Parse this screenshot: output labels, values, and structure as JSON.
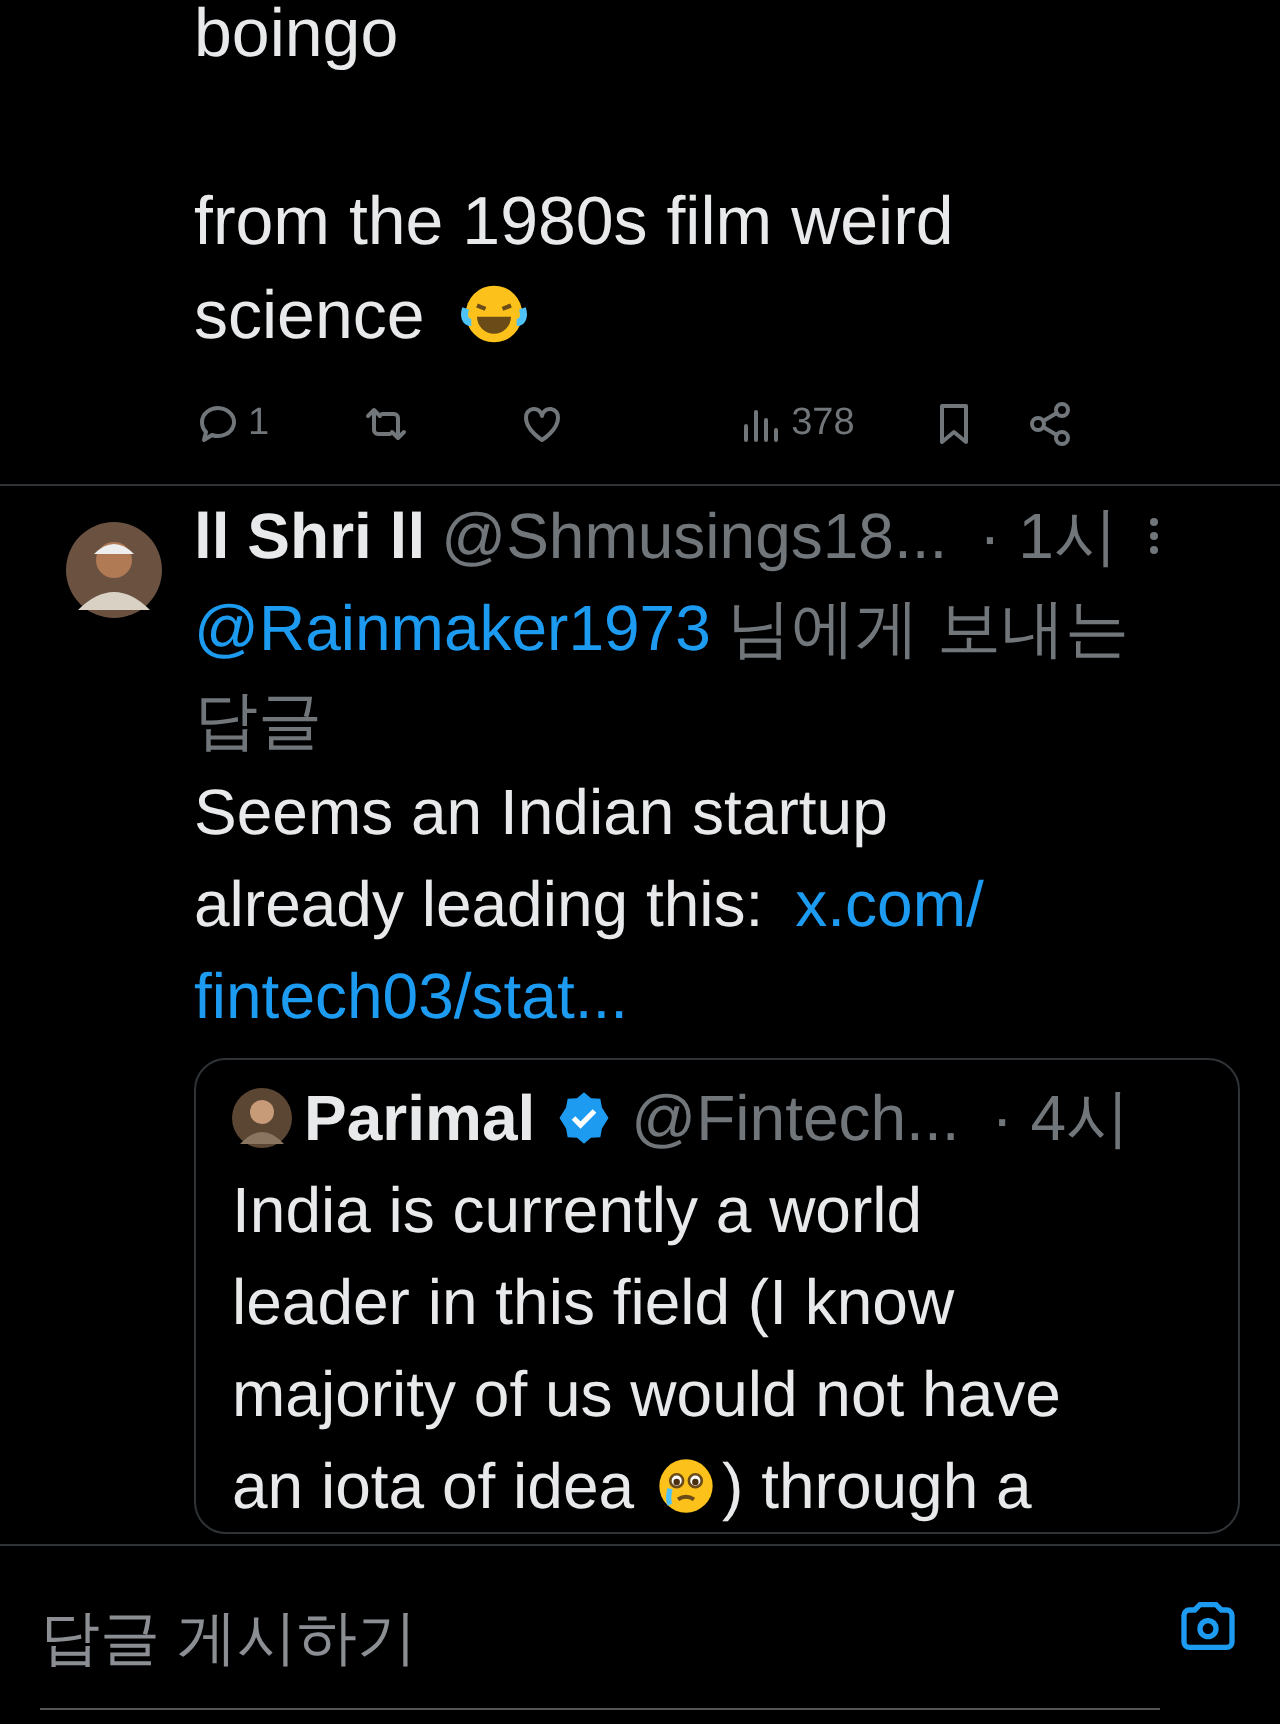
{
  "tweet": {
    "text_lines": [
      "boingo",
      "from the 1980s film weird",
      "science"
    ],
    "actions": [
      {
        "kind": "reply",
        "count": "1"
      },
      {
        "kind": "repost"
      },
      {
        "kind": "like"
      },
      {
        "kind": "views",
        "count": "378"
      },
      {
        "kind": "bookmark"
      },
      {
        "kind": "share"
      }
    ]
  },
  "reply": {
    "name": "ll Shri ll",
    "handle": "@Shmusings18...",
    "time": "· 1시",
    "mention": "@Rainmaker1973",
    "replying_suffix_lines": [
      "님에게 보내는",
      "답글"
    ],
    "text_lines": [
      "Seems an Indian startup",
      "already leading this:"
    ],
    "link_lines": [
      "x.com/",
      "fintech03/stat..."
    ],
    "quote": {
      "name": "Parimal",
      "verified": true,
      "handle": "@Fintech...",
      "time": "· 4시",
      "text_lines": [
        "India is currently a world",
        "leader in this field (I know",
        "majority of us would not have",
        "an iota of idea"
      ],
      "text_after": ") through a"
    }
  },
  "composer": {
    "placeholder": "답글 게시하기"
  }
}
